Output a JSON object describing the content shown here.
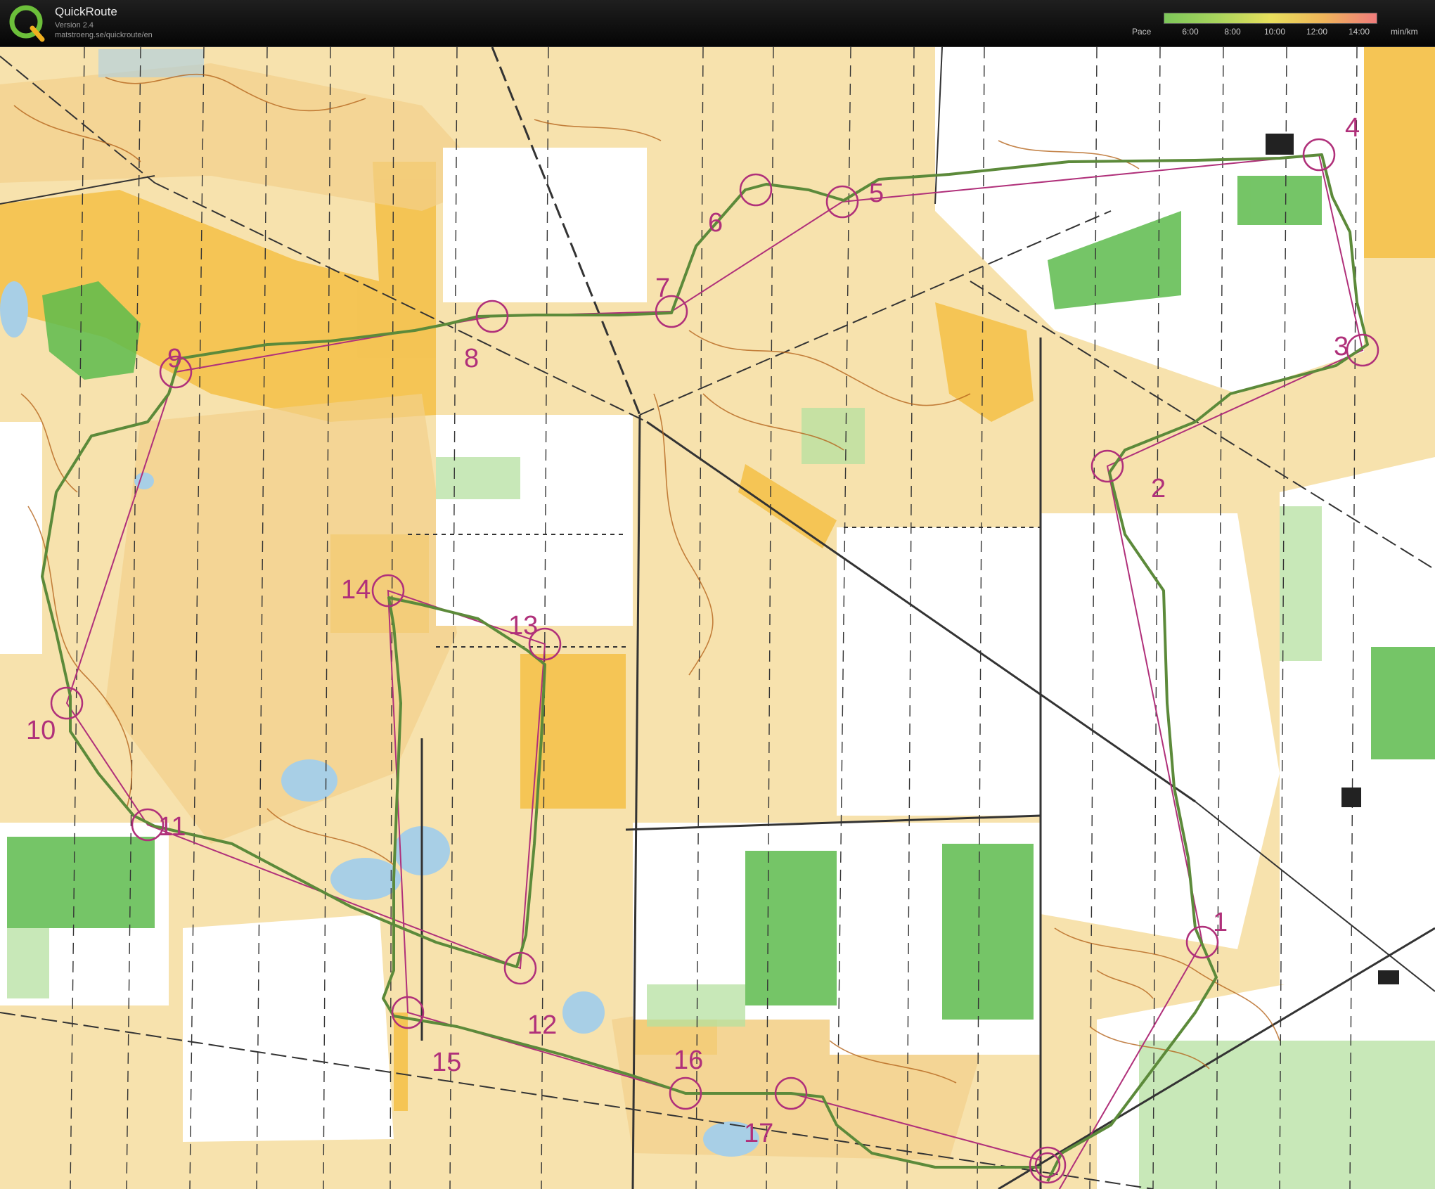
{
  "app": {
    "name": "QuickRoute",
    "version": "Version 2.4",
    "url": "matstroeng.se/quickroute/en"
  },
  "pace_legend": {
    "label": "Pace",
    "ticks": [
      "6:00",
      "8:00",
      "10:00",
      "12:00",
      "14:00"
    ],
    "unit": "min/km",
    "colors": [
      "#7dc75a",
      "#a8d45c",
      "#e7df5c",
      "#f0b55a",
      "#f07c7c"
    ]
  },
  "map": {
    "course_color": "#b0307a",
    "route_color": "#5c8a3a",
    "controls": [
      {
        "label": "1"
      },
      {
        "label": "2"
      },
      {
        "label": "3"
      },
      {
        "label": "4"
      },
      {
        "label": "5"
      },
      {
        "label": "6"
      },
      {
        "label": "7"
      },
      {
        "label": "8"
      },
      {
        "label": "9"
      },
      {
        "label": "10"
      },
      {
        "label": "11"
      },
      {
        "label": "12"
      },
      {
        "label": "13"
      },
      {
        "label": "14"
      },
      {
        "label": "15"
      },
      {
        "label": "16"
      },
      {
        "label": "17"
      }
    ]
  }
}
